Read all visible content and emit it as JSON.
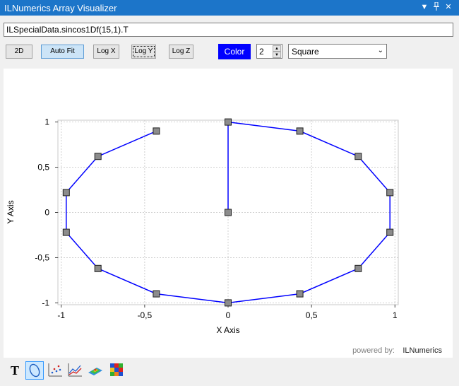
{
  "window": {
    "title": "ILNumerics Array Visualizer",
    "menu_icon": "dropdown-arrow-icon",
    "pin_icon": "pin-icon",
    "close_icon": "close-icon"
  },
  "expression": {
    "value": "ILSpecialData.sincos1Df(15,1).T"
  },
  "toolbar": {
    "btn_2d": "2D",
    "btn_autofit": "Auto Fit",
    "btn_logx": "Log X",
    "btn_logy": "Log Y",
    "btn_logz": "Log Z",
    "color_label": "Color",
    "color_value": "#0000ff",
    "line_width": "2",
    "marker_style": "Square"
  },
  "plot": {
    "watermark_powered": "powered by:",
    "watermark_brand": "ILNumerics"
  },
  "bottom_tools": [
    "text-tool-icon",
    "line-plot-icon",
    "scatter-plot-icon",
    "multi-line-plot-icon",
    "surface-plot-icon",
    "image-plot-icon"
  ],
  "chart_data": {
    "type": "line",
    "xlabel": "X Axis",
    "ylabel": "Y Axis",
    "xlim": [
      -1.02,
      1.02
    ],
    "ylim": [
      -1.02,
      1.02
    ],
    "xticks": [
      -1,
      -0.5,
      0,
      0.5,
      1
    ],
    "xtick_labels": [
      "-1",
      "-0,5",
      "0",
      "0,5",
      "1"
    ],
    "yticks": [
      -1,
      -0.5,
      0,
      0.5,
      1
    ],
    "ytick_labels": [
      "-1",
      "-0,5",
      "0",
      "0,5",
      "1"
    ],
    "grid": true,
    "line_color": "#0000ff",
    "marker": "square",
    "x": [
      0,
      0,
      0.43,
      0.78,
      0.97,
      0.97,
      0.78,
      0.43,
      0,
      -0.43,
      -0.78,
      -0.97,
      -0.97,
      -0.78,
      -0.43
    ],
    "y": [
      0,
      1,
      0.9,
      0.62,
      0.22,
      -0.22,
      -0.62,
      -0.9,
      -1,
      -0.9,
      -0.62,
      -0.22,
      0.22,
      0.62,
      0.9
    ]
  }
}
